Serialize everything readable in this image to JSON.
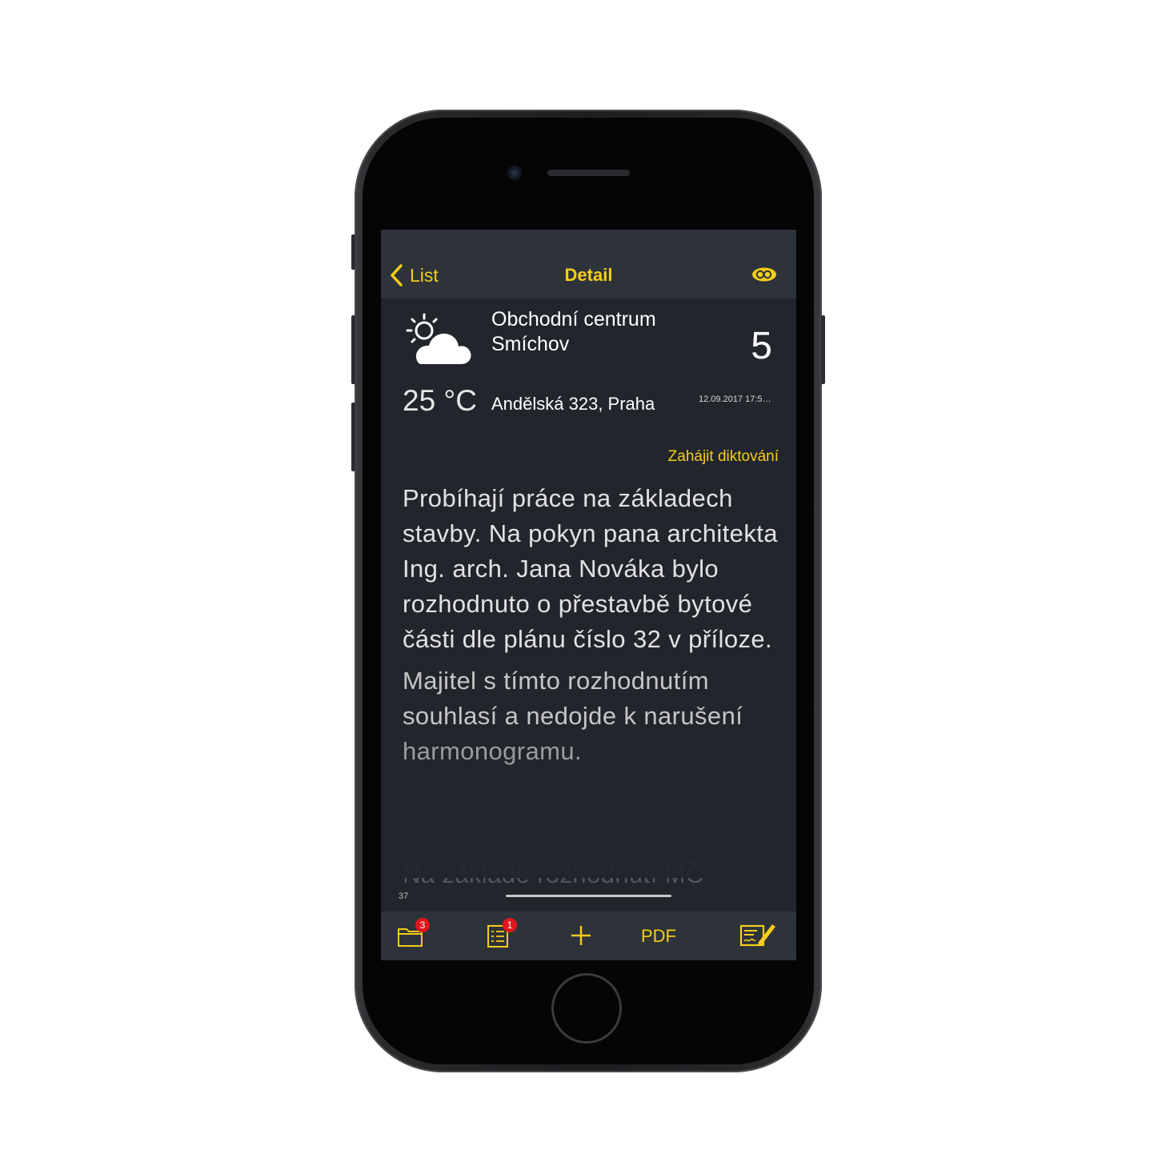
{
  "navbar": {
    "back_label": "List",
    "title": "Detail",
    "link_icon": "infinity-link-icon"
  },
  "entry": {
    "site_name": "Obchodní centrum Smíchov",
    "count": "5",
    "temperature": "25 °C",
    "address": "Andělská 323, Praha",
    "timestamp": "12.09.2017 17:5…",
    "weather_icon": "partly-cloudy-icon"
  },
  "dictation_label": "Zahájit diktování",
  "note": {
    "paragraph1": "Probíhají práce na základech stavby. Na pokyn pana architekta Ing. arch. Jana Nováka bylo rozhodnuto o přestavbě bytové části dle plánu číslo 32 v příloze.",
    "paragraph2_a": "Majitel s tímto rozhodnutím souhlasí a nedojde k narušení",
    "paragraph2_b": "harmonogramu.",
    "paragraph3": "Na základě rozhodnutí MČ"
  },
  "char_count": "37",
  "toolbar": {
    "folder_badge": "3",
    "list_badge": "1",
    "pdf_label": "PDF",
    "icons": [
      "folder-icon",
      "checklist-icon",
      "plus-icon",
      "pdf-button",
      "signature-icon"
    ]
  },
  "colors": {
    "accent": "#f5cc1a",
    "background": "#22262c",
    "bar": "#2e333a",
    "badge": "#e0161d"
  }
}
